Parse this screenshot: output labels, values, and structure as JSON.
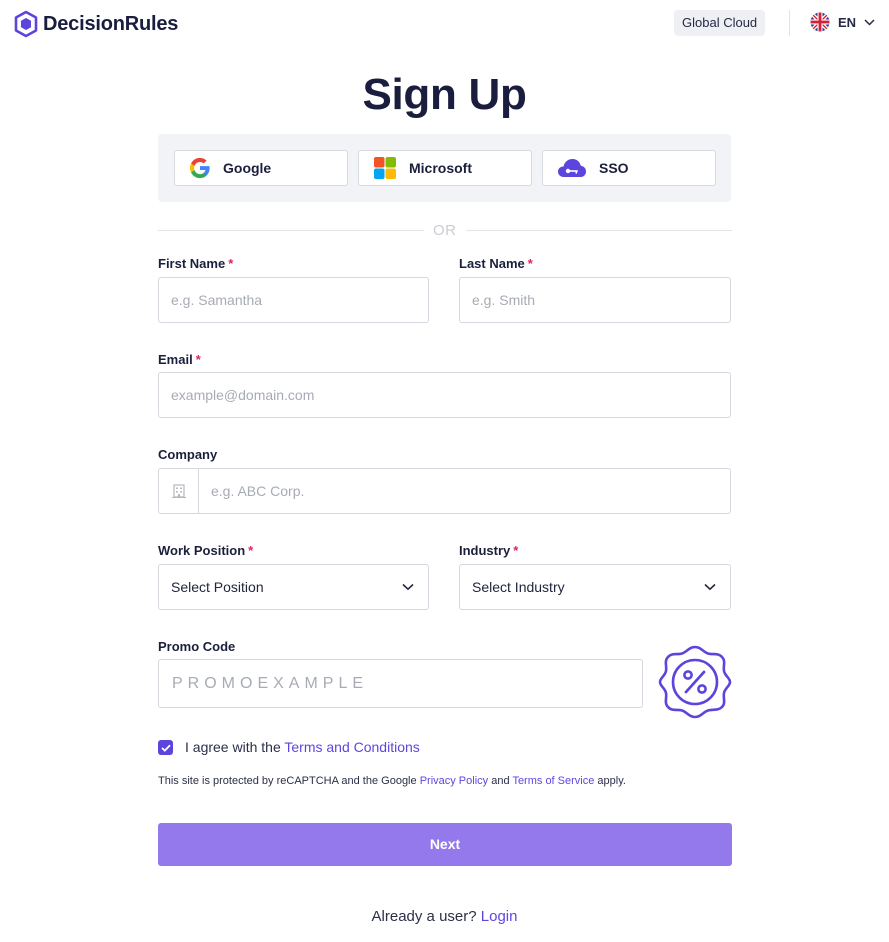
{
  "header": {
    "brand": "DecisionRules",
    "region": "Global Cloud",
    "language": "EN"
  },
  "title": "Sign Up",
  "social": {
    "google": "Google",
    "microsoft": "Microsoft",
    "sso": "SSO"
  },
  "divider_text": "OR",
  "form": {
    "first_name": {
      "label": "First Name",
      "required_mark": "*",
      "placeholder": "e.g. Samantha"
    },
    "last_name": {
      "label": "Last Name",
      "required_mark": "*",
      "placeholder": "e.g. Smith"
    },
    "email": {
      "label": "Email",
      "required_mark": "*",
      "placeholder": "example@domain.com"
    },
    "company": {
      "label": "Company",
      "placeholder": "e.g. ABC Corp."
    },
    "work_position": {
      "label": "Work Position",
      "required_mark": "*",
      "value": "Select Position"
    },
    "industry": {
      "label": "Industry",
      "required_mark": "*",
      "value": "Select Industry"
    },
    "promo_code": {
      "label": "Promo Code",
      "placeholder": "PROMOEXAMPLE"
    }
  },
  "agree": {
    "checked": true,
    "text": "I agree with the ",
    "link": "Terms and Conditions"
  },
  "recaptcha": {
    "prefix": "This site is protected by reCAPTCHA and the Google ",
    "privacy": "Privacy Policy",
    "and": " and ",
    "terms": "Terms of Service",
    "suffix": " apply."
  },
  "next_label": "Next",
  "footer": {
    "text": "Already a user? ",
    "login": "Login"
  },
  "colors": {
    "accent": "#5b45dc",
    "button": "#9479ec",
    "required": "#e0245e"
  }
}
